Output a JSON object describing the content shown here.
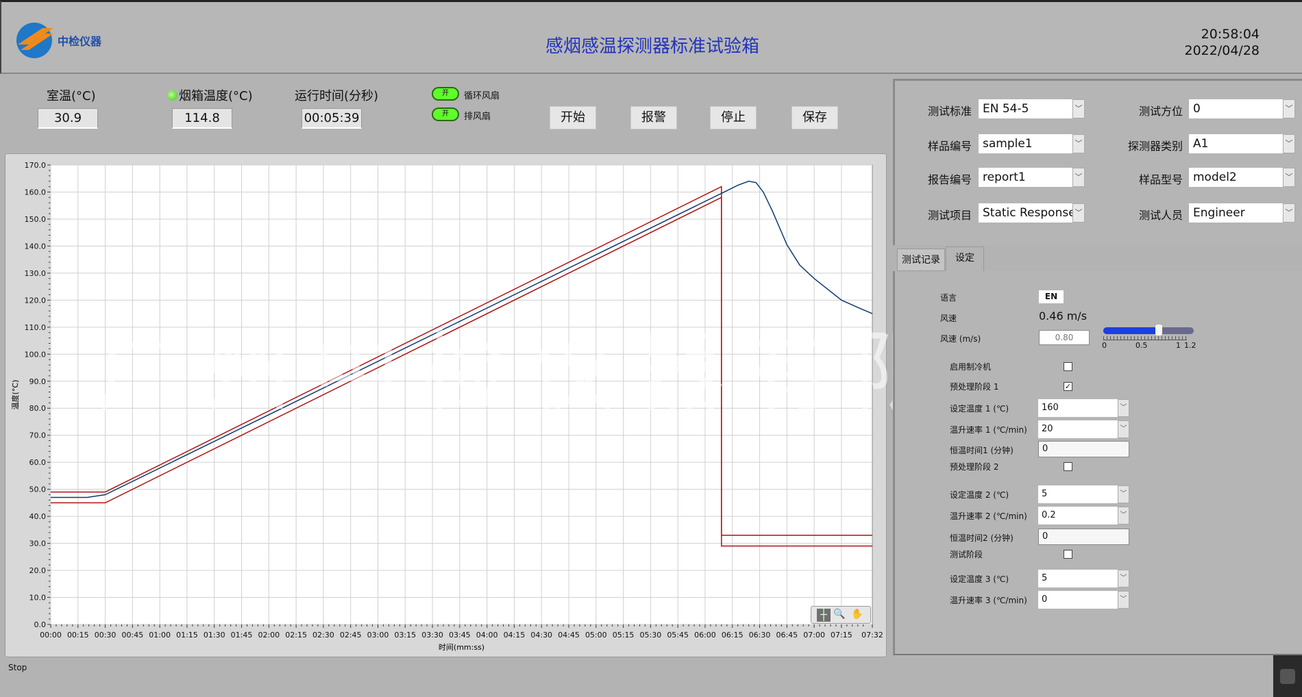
{
  "header": {
    "title": "感烟感温探测器标准试验箱",
    "time": "20:58:04",
    "date": "2022/04/28",
    "logo_text": "中检仪器"
  },
  "readouts": {
    "room_temp_label": "室温(°C)",
    "room_temp": "30.9",
    "box_temp_label": "烟箱温度(°C)",
    "box_temp": "114.8",
    "run_time_label": "运行时间(分秒)",
    "run_time": "00:05:39"
  },
  "fans": [
    {
      "state": "开",
      "label": "循环风扇"
    },
    {
      "state": "开",
      "label": "排风扇"
    }
  ],
  "buttons": {
    "start": "开始",
    "alarm": "报警",
    "stop": "停止",
    "save": "保存"
  },
  "colors": {
    "title": "#2233bb",
    "indicator": "#5eff2a",
    "limit_line": "#b01010",
    "temp_line": "#0d3a6e"
  },
  "form": {
    "left": [
      {
        "label": "测试标准",
        "value": "EN 54-5"
      },
      {
        "label": "样品编号",
        "value": "sample1"
      },
      {
        "label": "报告编号",
        "value": "report1"
      },
      {
        "label": "测试项目",
        "value": "Static Response"
      }
    ],
    "right": [
      {
        "label": "测试方位",
        "value": "0"
      },
      {
        "label": "探测器类别",
        "value": "A1"
      },
      {
        "label": "样品型号",
        "value": "model2"
      },
      {
        "label": "测试人员",
        "value": "Engineer"
      }
    ]
  },
  "tabs": [
    {
      "label": "测试记录"
    },
    {
      "label": "设定",
      "active": true
    }
  ],
  "settings": {
    "language_label": "语言",
    "language": "EN",
    "wind_label": "风速",
    "wind_value": "0.46 m/s",
    "wind_set_label": "风速 (m/s)",
    "wind_set": "0.80",
    "slider": {
      "value": 0.8,
      "min": 0,
      "max": 1.2,
      "ticks": [
        "0",
        "0.5",
        "1",
        "1.2"
      ]
    },
    "chiller_label": "启用制冷机",
    "chiller": false,
    "stage1_label": "预处理阶段 1",
    "stage1": true,
    "set_temp1_label": "设定温度 1 (℃)",
    "set_temp1": "160",
    "rate1_label": "温升速率 1 (℃/min)",
    "rate1": "20",
    "hold1_label": "恒温时间1 (分钟)",
    "hold1": "0",
    "stage2_label": "预处理阶段 2",
    "stage2": false,
    "set_temp2_label": "设定温度 2 (℃)",
    "set_temp2": "5",
    "rate2_label": "温升速率 2 (℃/min)",
    "rate2": "0.2",
    "hold2_label": "恒温时间2 (分钟)",
    "hold2": "0",
    "test_stage_label": "测试阶段",
    "test_stage": false,
    "set_temp3_label": "设定温度 3 (℃)",
    "set_temp3": "5",
    "rate3_label": "温升速率 3 (℃/min)",
    "rate3": "0"
  },
  "status": "Stop",
  "watermark": "广州中检仪器有限公司",
  "chart_data": {
    "type": "line",
    "xlabel": "时间(mm:ss)",
    "ylabel": "温度(°C)",
    "xlim": [
      0,
      452
    ],
    "ylim": [
      0,
      170
    ],
    "grid": true,
    "x_ticks": [
      "00:00",
      "00:15",
      "00:30",
      "00:45",
      "01:00",
      "01:15",
      "01:30",
      "01:45",
      "02:00",
      "02:15",
      "02:30",
      "02:45",
      "03:00",
      "03:15",
      "03:30",
      "03:45",
      "04:00",
      "04:15",
      "04:30",
      "04:45",
      "05:00",
      "05:15",
      "05:30",
      "05:45",
      "06:00",
      "06:15",
      "06:30",
      "06:45",
      "07:00",
      "07:15",
      "07:32"
    ],
    "y_ticks": [
      "0.0",
      "10.0",
      "20.0",
      "30.0",
      "40.0",
      "50.0",
      "60.0",
      "70.0",
      "80.0",
      "90.0",
      "100.0",
      "110.0",
      "120.0",
      "130.0",
      "140.0",
      "150.0",
      "160.0",
      "170.0"
    ],
    "series": [
      {
        "color": "#b01010",
        "points": [
          [
            0,
            49
          ],
          [
            30,
            49
          ],
          [
            369,
            162
          ],
          [
            369,
            33
          ],
          [
            452,
            33
          ]
        ]
      },
      {
        "color": "#b01010",
        "points": [
          [
            0,
            45
          ],
          [
            30,
            45
          ],
          [
            369,
            158
          ],
          [
            369,
            29
          ],
          [
            452,
            29
          ]
        ]
      },
      {
        "color": "#0d3a6e",
        "points": [
          [
            0,
            47
          ],
          [
            20,
            47
          ],
          [
            30,
            48
          ],
          [
            369,
            159.5
          ],
          [
            378,
            162.5
          ],
          [
            384,
            164
          ],
          [
            388,
            163.5
          ],
          [
            392,
            160
          ],
          [
            397,
            153
          ],
          [
            405,
            140.5
          ],
          [
            412,
            133
          ],
          [
            420,
            128
          ],
          [
            435,
            120
          ],
          [
            445,
            117
          ],
          [
            452,
            115
          ]
        ]
      }
    ]
  }
}
